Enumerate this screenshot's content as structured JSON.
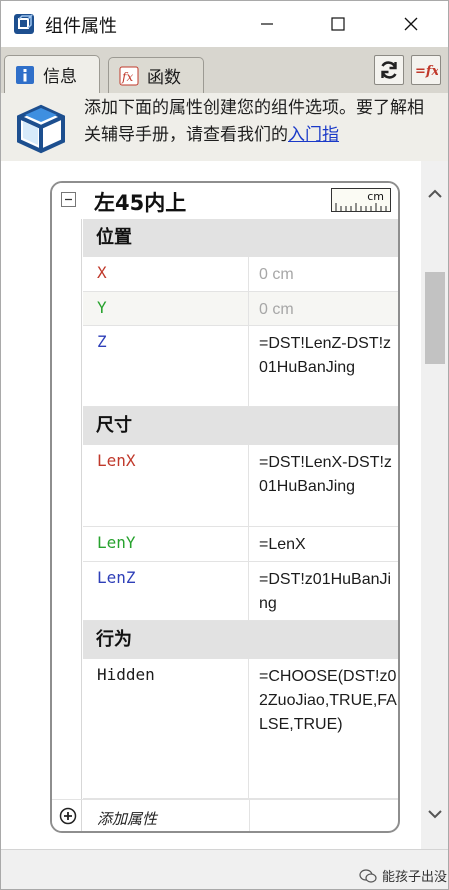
{
  "window": {
    "title": "组件属性",
    "minimize_label": "—",
    "maximize_label": "□",
    "close_label": "✕"
  },
  "tabs": [
    {
      "label": "信息",
      "active": true
    },
    {
      "label": "函数",
      "active": false
    }
  ],
  "info": {
    "text": "添加下面的属性创建您的组件选项。要了解相关辅导手册，请查看我们的",
    "link": "入门指"
  },
  "component": {
    "name": "左45内上",
    "unit": "cm"
  },
  "sections": [
    {
      "title": "位置",
      "rows": [
        {
          "name": "X",
          "value": "0 cm",
          "color": "#c0392b",
          "muted": true
        },
        {
          "name": "Y",
          "value": "0 cm",
          "color": "#27a22e",
          "muted": true
        },
        {
          "name": "Z",
          "value": "=DST!LenZ-DST!z01HuBanJing",
          "color": "#2e3fb8",
          "muted": false
        }
      ]
    },
    {
      "title": "尺寸",
      "rows": [
        {
          "name": "LenX",
          "value": "=DST!LenX-DST!z01HuBanJing",
          "color": "#c0392b",
          "muted": false
        },
        {
          "name": "LenY",
          "value": "=LenX",
          "color": "#27a22e",
          "muted": false
        },
        {
          "name": "LenZ",
          "value": "=DST!z01HuBanJing",
          "color": "#2e3fb8",
          "muted": false
        }
      ]
    },
    {
      "title": "行为",
      "rows": [
        {
          "name": "Hidden",
          "value": "=CHOOSE(DST!z02ZuoJiao,TRUE,FALSE,TRUE)",
          "color": "#1c1c1c",
          "muted": false
        }
      ]
    }
  ],
  "add_property_label": "添加属性",
  "watermark": "能孩子出没",
  "colors": {
    "accent_link": "#1a39c8",
    "tab_strip": "#d8d6cf",
    "section_bg": "#e2e2e2"
  }
}
